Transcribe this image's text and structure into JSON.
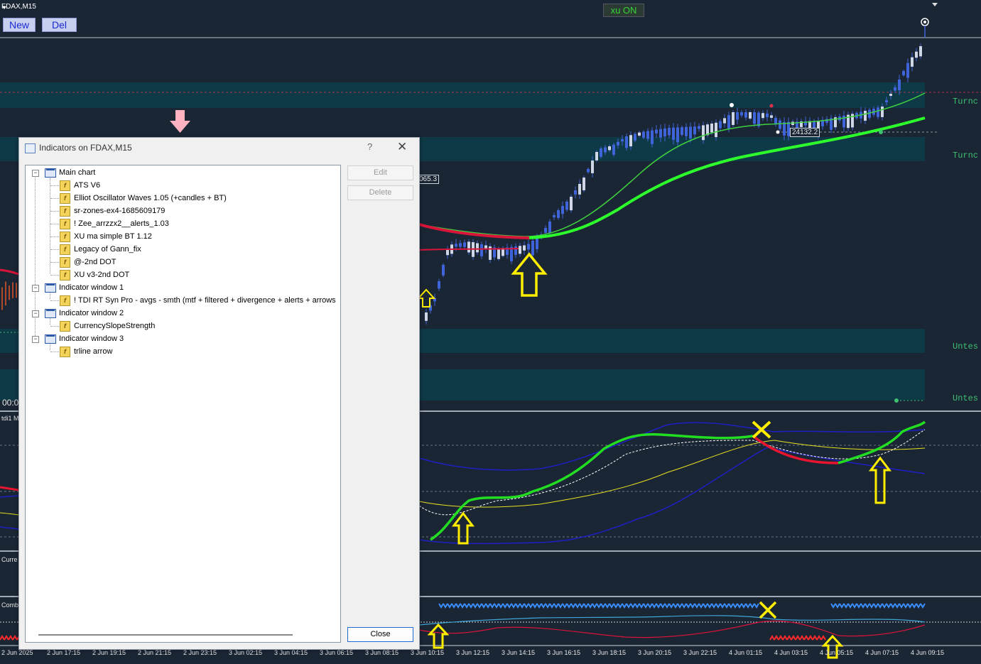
{
  "chart": {
    "symbol_title": "FDAX,M15",
    "buttons": {
      "new": "New",
      "del": "Del"
    },
    "xu_status": "xu ON",
    "zone_labels": [
      "Turnc",
      "Turnc",
      "Untes",
      "Untes"
    ],
    "price_tags": {
      "main": "24132.2",
      "partial": "065.3"
    },
    "left_time_fragment": "00:0",
    "pane_labels": {
      "tdi": "tdi1 M",
      "currency": "Curre",
      "combo": "Comb"
    },
    "time_axis": [
      "2 Jun 2025",
      "2 Jun 17:15",
      "2 Jun 19:15",
      "2 Jun 21:15",
      "2 Jun 23:15",
      "3 Jun 02:15",
      "3 Jun 04:15",
      "3 Jun 06:15",
      "3 Jun 08:15",
      "3 Jun 10:15",
      "3 Jun 12:15",
      "3 Jun 14:15",
      "3 Jun 16:15",
      "3 Jun 18:15",
      "3 Jun 20:15",
      "3 Jun 22:15",
      "4 Jun 01:15",
      "4 Jun 03:15",
      "4 Jun 05:15",
      "4 Jun 07:15",
      "4 Jun 09:15"
    ],
    "colors": {
      "background": "#1b2635",
      "zone": "#0e3a47",
      "bull": "#3f63d8",
      "ma_fast": "#3fd13f",
      "ma_slow": "#2dff2d",
      "ma_red": "#d8143a",
      "arrow": "#ffee00",
      "zone_text": "#3dbf6f"
    }
  },
  "dialog": {
    "title": "Indicators on FDAX,M15",
    "help": "?",
    "close_x": "✕",
    "buttons": {
      "edit": "Edit",
      "delete": "Delete",
      "close": "Close"
    },
    "tree": {
      "main_chart": {
        "label": "Main chart",
        "items": [
          "ATS V6",
          "Elliot Oscillator Waves 1.05 (+candles + BT)",
          "sr-zones-ex4-1685609179",
          "! Zee_arrzzx2__alerts_1.03",
          "XU ma simple BT 1.12",
          "Legacy of Gann_fix",
          "@-2nd DOT",
          "XU v3-2nd DOT"
        ]
      },
      "window1": {
        "label": "Indicator window 1",
        "items": [
          "! TDI RT Syn Pro - avgs - smth  (mtf + filtered + divergence + alerts + arrows"
        ]
      },
      "window2": {
        "label": "Indicator window 2",
        "items": [
          "CurrencySlopeStrength"
        ]
      },
      "window3": {
        "label": "Indicator window 3",
        "items": [
          "trline arrow"
        ]
      }
    }
  }
}
